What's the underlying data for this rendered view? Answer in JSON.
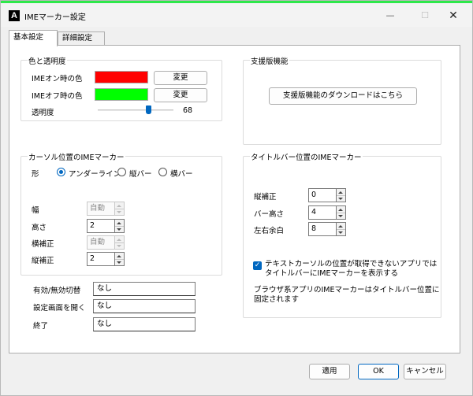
{
  "window": {
    "title": "IMEマーカー設定",
    "app_icon_letter": "A",
    "controls": {
      "minimize": "—",
      "maximize": "☐",
      "close": "✕"
    }
  },
  "tabs": [
    {
      "label": "基本設定",
      "active": true
    },
    {
      "label": "詳細設定",
      "active": false
    }
  ],
  "color_group": {
    "title": "色と透明度",
    "ime_on_label": "IMEオン時の色",
    "ime_on_color": "#ff0000",
    "ime_off_label": "IMEオフ時の色",
    "ime_off_color": "#00ff00",
    "change_label": "変更",
    "opacity_label": "透明度",
    "opacity_value": "68",
    "opacity_fraction": 0.68
  },
  "support_group": {
    "title": "支援版機能",
    "download_label": "支援版機能のダウンロードはこちら"
  },
  "cursor_group": {
    "title": "カーソル位置のIMEマーカー",
    "shape_label": "形",
    "shape_options": [
      "アンダーライン",
      "縦バー",
      "横バー"
    ],
    "shape_selected": 0,
    "width_label": "幅",
    "width_value": "自動",
    "height_label": "高さ",
    "height_value": "2",
    "hoffset_label": "横補正",
    "hoffset_value": "自動",
    "voffset_label": "縦補正",
    "voffset_value": "2"
  },
  "titlebar_group": {
    "title": "タイトルバー位置のIMEマーカー",
    "voffset_label": "縦補正",
    "voffset_value": "0",
    "barheight_label": "バー高さ",
    "barheight_value": "4",
    "margin_label": "左右余白",
    "margin_value": "8",
    "checkbox_line1": "テキストカーソルの位置が取得できないアプリでは",
    "checkbox_line2": "タイトルバーにIMEマーカーを表示する",
    "checkbox_checked": true,
    "note_line1": "ブラウザ系アプリのIMEマーカーはタイトルバー位置に",
    "note_line2": "固定されます"
  },
  "hotkeys": {
    "toggle_label": "有効/無効切替",
    "toggle_value": "なし",
    "settings_label": "設定画面を開く",
    "settings_value": "なし",
    "exit_label": "終了",
    "exit_value": "なし"
  },
  "footer": {
    "apply_label": "適用",
    "ok_label": "OK",
    "cancel_label": "キャンセル"
  }
}
